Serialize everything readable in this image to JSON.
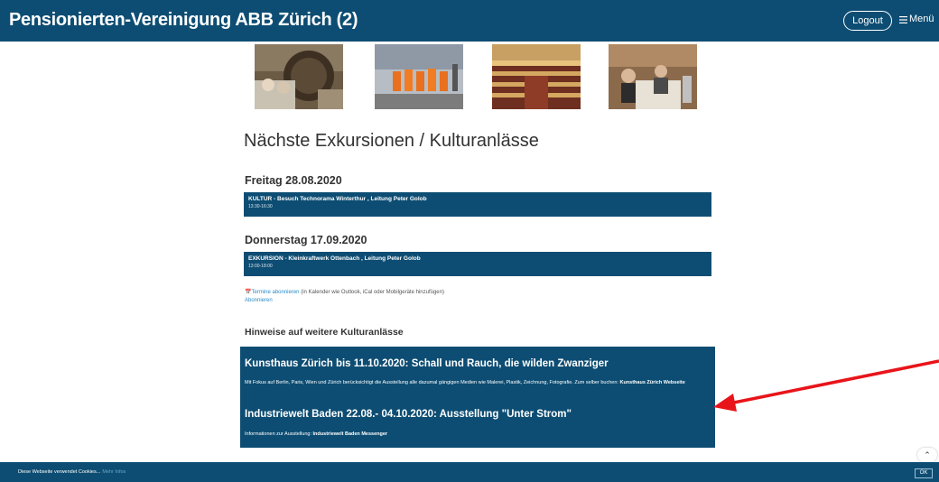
{
  "header": {
    "title": "Pensionierten-Vereinigung ABB Zürich (2)",
    "logout_label": "Logout",
    "menu_label": "Menü"
  },
  "photos": [
    {
      "alt": "photo-1"
    },
    {
      "alt": "photo-2"
    },
    {
      "alt": "photo-3"
    },
    {
      "alt": "photo-4"
    }
  ],
  "main": {
    "heading": "Nächste Exkursionen / Kulturanlässe",
    "days": [
      {
        "date": "Freitag 28.08.2020",
        "event_title": "KULTUR - Besuch Technorama Winterthur , Leitung Peter Golob",
        "event_time": "13:30-16:30"
      },
      {
        "date": "Donnerstag 17.09.2020",
        "event_title": "EXKURSION - Kleinkraftwerk Ottenbach , Leitung Peter Golob",
        "event_time": "13:00-18:00"
      }
    ],
    "subscribe_link": "Termine abonnieren",
    "subscribe_note": "(in Kalender wie Outlook, iCal oder Mobilgeräte hinzufügen)",
    "subscribe_link2": "Abonnieren",
    "hinweise_heading": "Hinweise auf weitere Kulturanlässe",
    "kultur": {
      "h1": "Kunsthaus Zürich bis 11.10.2020: Schall und Rauch, die wilden Zwanziger",
      "p1": "Mit Fokus auf Berlin, Paris, Wien und Zürich berücksichtigt die Ausstellung alle dazumal gängigen Medien wie Malerei, Plastik, Zeichnung, Fotografie. Zum selber buchen:",
      "p1_link": "Kunsthaus Zürich Webseite",
      "h2": "Industriewelt Baden 22.08.- 04.10.2020: Ausstellung \"Unter Strom\"",
      "p2": "Informationen zur Ausstellung:",
      "p2_link": "Industriewelt Baden Messenger"
    }
  },
  "cookie": {
    "text": "Diese Webseite verwendet Cookies...",
    "more": "Mehr Infos",
    "ok": "OK"
  },
  "scroll_up_icon": "chevron-up-icon",
  "colors": {
    "brand": "#0d4d73",
    "arrow": "#e8141a",
    "link": "#2c8bc7"
  }
}
